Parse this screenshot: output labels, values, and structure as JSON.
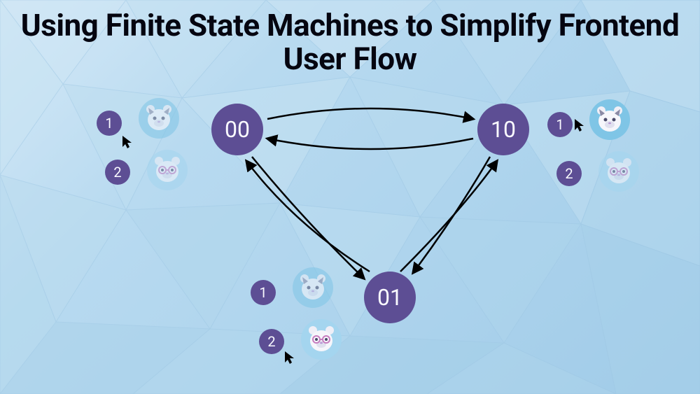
{
  "title": "Using Finite State Machines to Simplify Frontend User Flow",
  "states": {
    "s00": "00",
    "s10": "10",
    "s01": "01"
  },
  "groups": {
    "left": {
      "badge1": "1",
      "badge2": "2",
      "avatar1_icon": "tiger-icon",
      "avatar2_icon": "tiger-glasses-icon",
      "avatar1_dim": true,
      "avatar2_dim": true
    },
    "right": {
      "badge1": "1",
      "badge2": "2",
      "avatar1_icon": "tiger-icon",
      "avatar2_icon": "tiger-glasses-icon",
      "avatar1_dim": false,
      "avatar2_dim": true
    },
    "bottom": {
      "badge1": "1",
      "badge2": "2",
      "avatar1_icon": "tiger-icon",
      "avatar2_icon": "tiger-glasses-icon",
      "avatar1_dim": true,
      "avatar2_dim": false
    }
  },
  "colors": {
    "node_bg": "#5d4e94",
    "node_text": "#fafaff",
    "avatar_blue": "#7fc5e6",
    "avatar_light": "#a4d5ef",
    "bg_from": "#d5e9f7",
    "bg_to": "#a0cbe8",
    "title_color": "#050510",
    "arrow_color": "#000000"
  }
}
